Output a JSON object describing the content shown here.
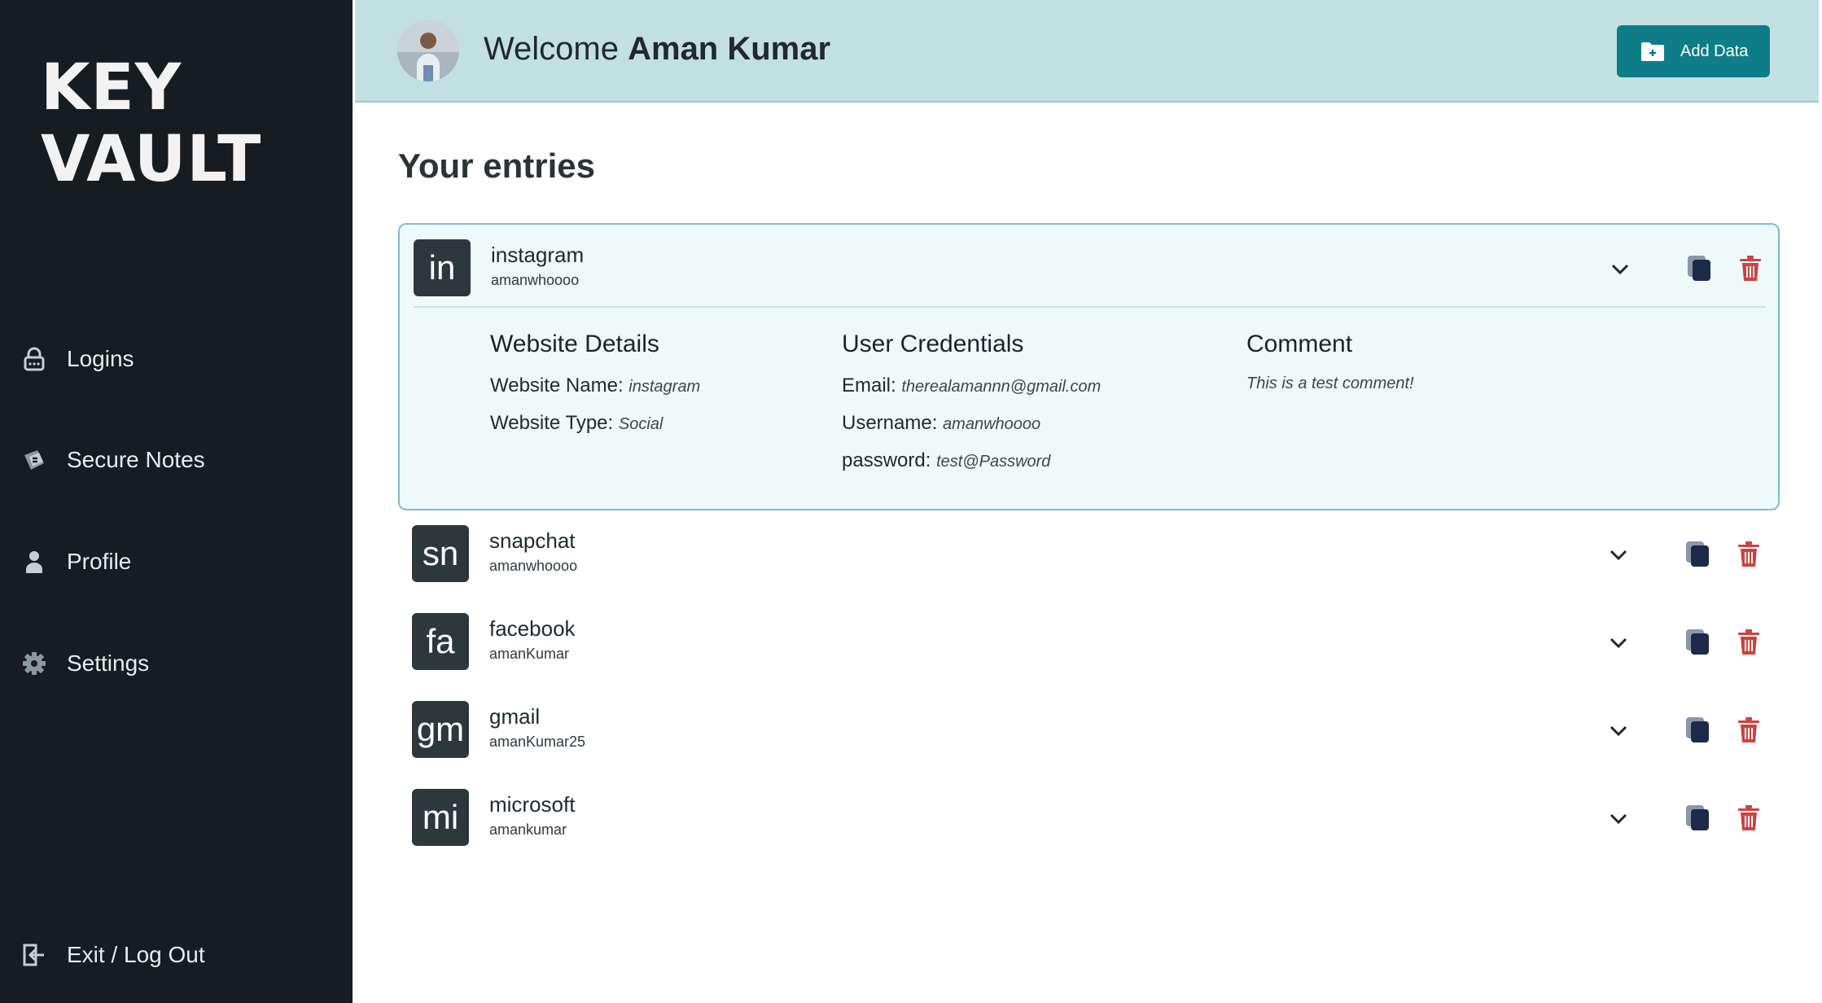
{
  "app": {
    "logo_line1": "KEY",
    "logo_line2": "VAULT"
  },
  "sidebar": {
    "items": [
      {
        "label": "Logins",
        "icon": "lock-icon"
      },
      {
        "label": "Secure Notes",
        "icon": "notes-icon"
      },
      {
        "label": "Profile",
        "icon": "user-icon"
      },
      {
        "label": "Settings",
        "icon": "gear-icon"
      }
    ],
    "logout_label": "Exit / Log Out"
  },
  "header": {
    "welcome_prefix": "Welcome",
    "user_name": "Aman Kumar",
    "add_button_label": "Add Data"
  },
  "main": {
    "title": "Your entries",
    "expanded_entry": {
      "abbr": "in",
      "site": "instagram",
      "username": "amanwhoooo",
      "website_details": {
        "heading": "Website Details",
        "name_label": "Website Name:",
        "name_value": "instagram",
        "type_label": "Website Type:",
        "type_value": "Social"
      },
      "user_credentials": {
        "heading": "User Credentials",
        "email_label": "Email:",
        "email_value": "therealamannn@gmail.com",
        "username_label": "Username:",
        "username_value": "amanwhoooo",
        "password_label": "password:",
        "password_value": "test@Password"
      },
      "comment": {
        "heading": "Comment",
        "text": "This is a test comment!"
      }
    },
    "entries": [
      {
        "abbr": "sn",
        "site": "snapchat",
        "username": "amanwhoooo"
      },
      {
        "abbr": "fa",
        "site": "facebook",
        "username": "amanKumar"
      },
      {
        "abbr": "gm",
        "site": "gmail",
        "username": "amanKumar25"
      },
      {
        "abbr": "mi",
        "site": "microsoft",
        "username": "amankumar"
      }
    ]
  },
  "colors": {
    "sidebar_bg": "#161c20",
    "header_bg": "#c2dfe2",
    "accent": "#0f7d87",
    "tile_bg": "#2d383d",
    "delete": "#c94444",
    "copy": "#1e2a4a"
  }
}
